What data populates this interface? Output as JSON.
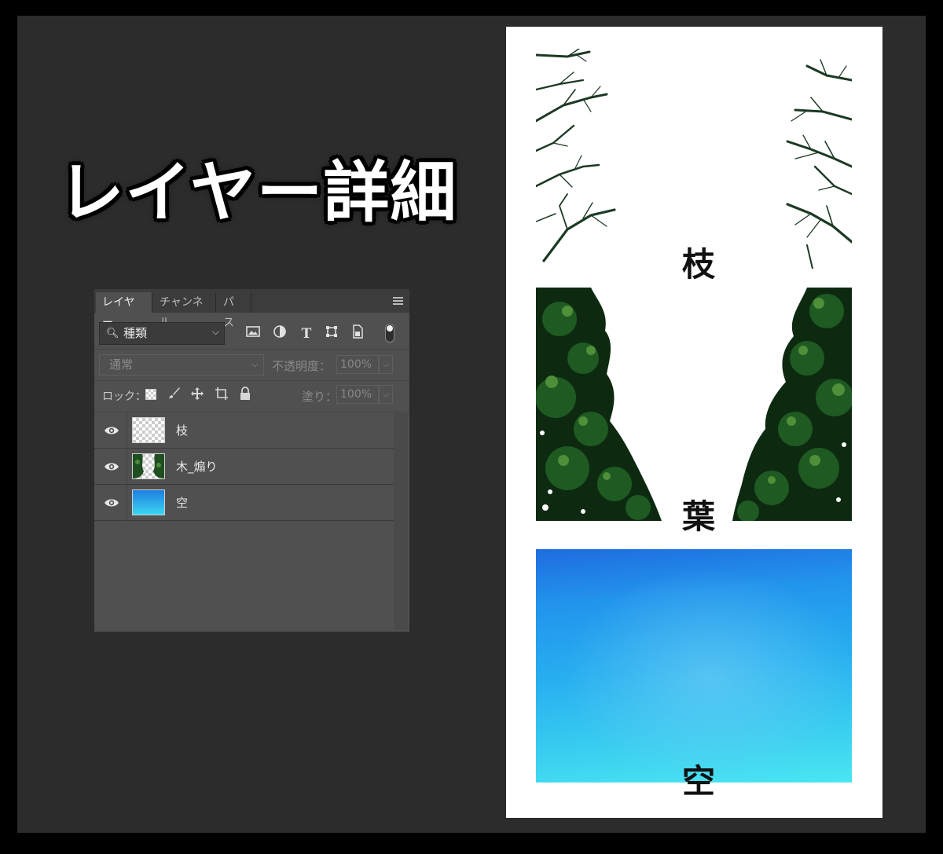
{
  "title": "レイヤー詳細",
  "panel": {
    "tabs": [
      "レイヤー",
      "チャンネル",
      "パス"
    ],
    "menu_icon": "panel-menu-icon",
    "filter": {
      "label": "種類",
      "icon": "search-icon"
    },
    "filter_icons": [
      "image-filter-icon",
      "adjustment-filter-icon",
      "type-filter-icon",
      "shape-filter-icon",
      "smart-object-filter-icon"
    ],
    "blend_mode": "通常",
    "opacity_label": "不透明度：",
    "opacity_value": "100%",
    "lock_label": "ロック：",
    "lock_icons": [
      "lock-transparent-icon",
      "lock-paint-icon",
      "lock-position-icon",
      "lock-artboard-icon",
      "lock-all-icon"
    ],
    "fill_label": "塗り：",
    "fill_value": "100%",
    "layers": [
      {
        "name": "枝",
        "visible": true,
        "thumb": "transparent"
      },
      {
        "name": "木_煽り",
        "visible": true,
        "thumb": "trees"
      },
      {
        "name": "空",
        "visible": true,
        "thumb": "sky"
      }
    ]
  },
  "preview": {
    "labels": {
      "branches": "枝",
      "leaves": "葉",
      "sky": "空"
    },
    "colors": {
      "leaf_dark": "#0d2a10",
      "leaf_mid": "#1e5a22",
      "leaf_light": "#4f8f3a",
      "branch": "#1d3a24",
      "sky_top": "#1f6ce0",
      "sky_bottom": "#4ae6f2"
    }
  }
}
